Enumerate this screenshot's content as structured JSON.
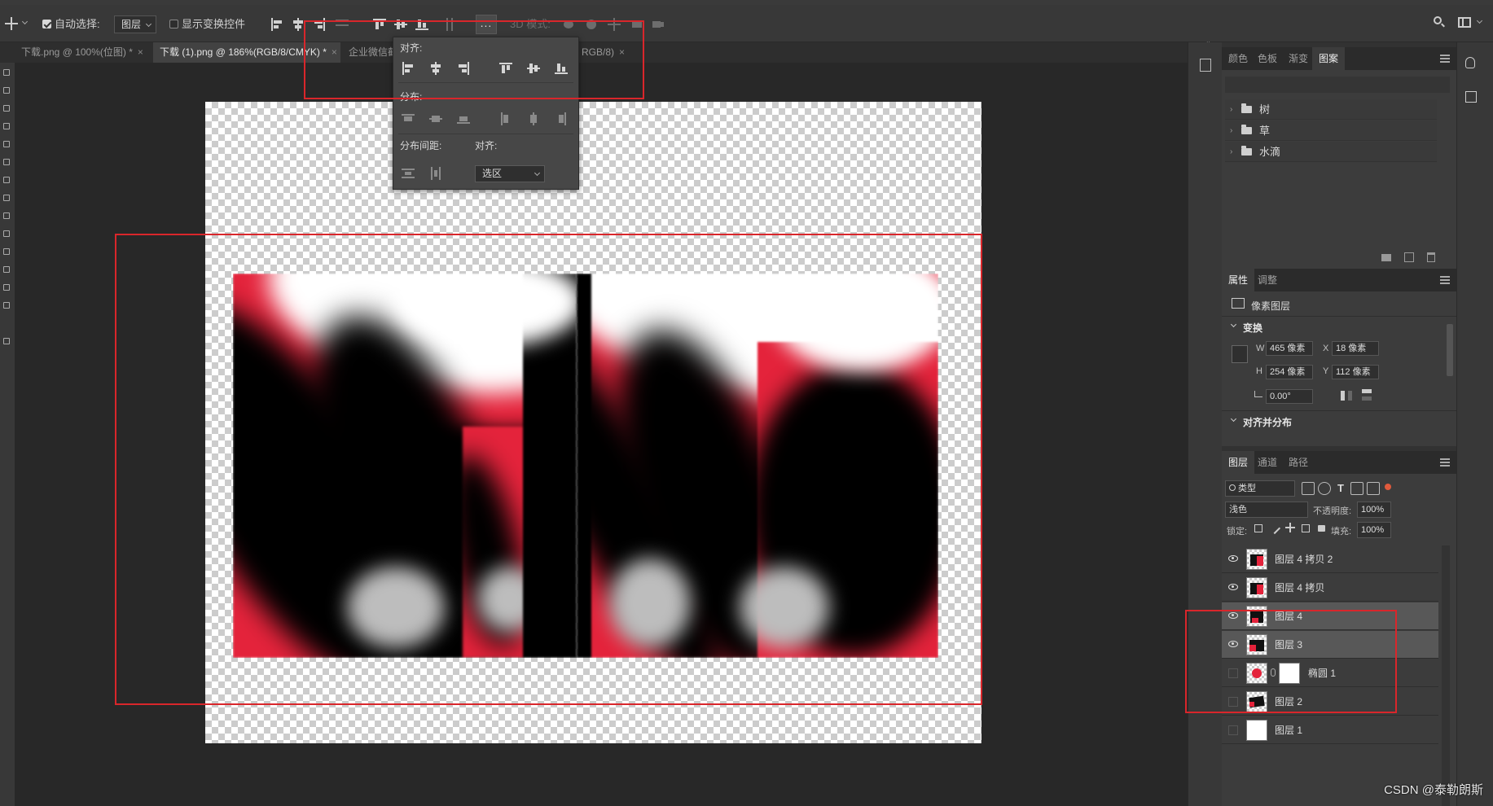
{
  "options_bar": {
    "auto_select_label": "自动选择:",
    "auto_select_target": "图层",
    "show_transform_label": "显示变换控件",
    "more_label": "...",
    "mode_3d_label": "3D 模式:"
  },
  "tabs": [
    {
      "label": "下载.png @ 100%(位图) *",
      "close": "×"
    },
    {
      "label": "下载 (1).png @ 186%(RGB/8/CMYK) *",
      "close": "×"
    },
    {
      "label": "企业微信截",
      "close": ""
    },
    {
      "label": "RGB/8)",
      "close": "×"
    }
  ],
  "align_flyout": {
    "align_title": "对齐:",
    "distribute_title": "分布:",
    "spacing_title": "分布间距:",
    "align_to_title": "对齐:",
    "align_to_value": "选区"
  },
  "swatches_panel": {
    "tabs": [
      "颜色",
      "色板",
      "渐变",
      "图案"
    ],
    "active_tab": "图案",
    "folders": [
      "树",
      "草",
      "水滴"
    ]
  },
  "properties_panel": {
    "tabs": [
      "属性",
      "调整"
    ],
    "active_tab": "属性",
    "kind": "像素图层",
    "transform_title": "变换",
    "w_label": "W",
    "w_value": "465 像素",
    "x_label": "X",
    "x_value": "18 像素",
    "h_label": "H",
    "h_value": "254 像素",
    "y_label": "Y",
    "y_value": "112 像素",
    "angle_value": "0.00°",
    "align_section_title": "对齐并分布"
  },
  "layers_panel": {
    "tabs": [
      "图层",
      "通道",
      "路径"
    ],
    "active_tab": "图层",
    "filter_kind": "类型",
    "blend_mode": "浅色",
    "opacity_label": "不透明度:",
    "opacity_value": "100%",
    "lock_label": "锁定:",
    "fill_label": "填充:",
    "fill_value": "100%",
    "layers": [
      {
        "name": "图层 4 拷贝 2",
        "visible": true,
        "selected": false
      },
      {
        "name": "图层 4 拷贝",
        "visible": true,
        "selected": false
      },
      {
        "name": "图层 4",
        "visible": true,
        "selected": true
      },
      {
        "name": "图层 3",
        "visible": true,
        "selected": true
      },
      {
        "name": "椭圆 1",
        "visible": false,
        "selected": false
      },
      {
        "name": "图层 2",
        "visible": false,
        "selected": false
      },
      {
        "name": "图层 1",
        "visible": false,
        "selected": false
      }
    ]
  },
  "watermark": "CSDN @泰勒朗斯",
  "colors": {
    "annotation_red": "#d9262b",
    "art_red": "#e4233b"
  }
}
